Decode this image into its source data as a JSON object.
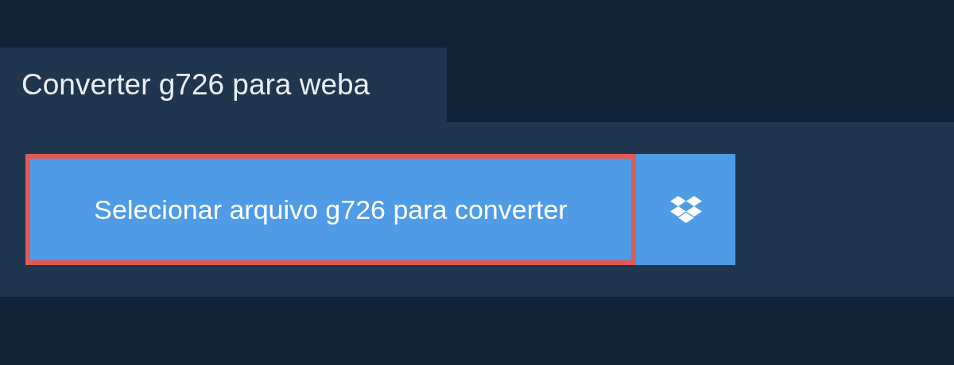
{
  "tab": {
    "title": "Converter g726 para weba"
  },
  "select_button": {
    "label": "Selecionar arquivo g726 para converter",
    "focused": true
  }
}
